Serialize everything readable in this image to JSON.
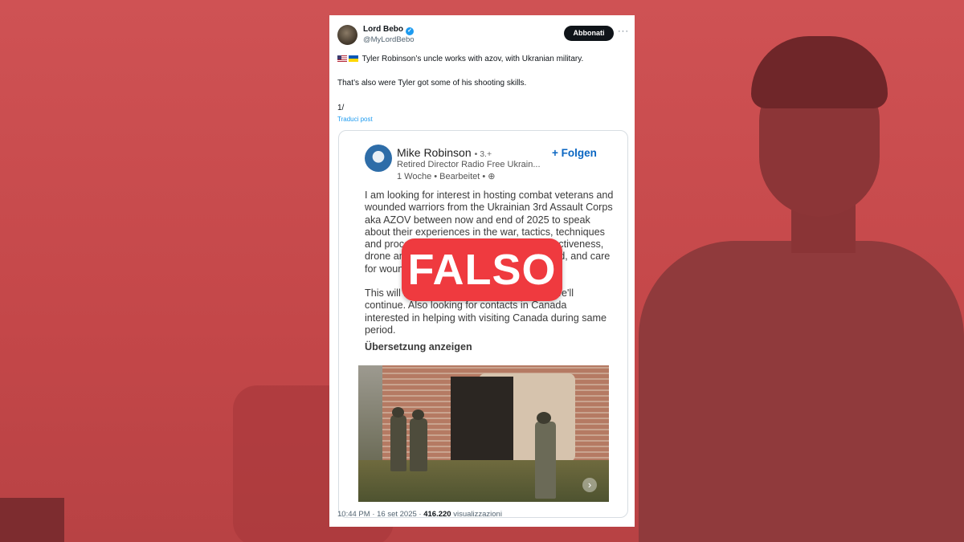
{
  "tweet": {
    "display_name": "Lord Bebo",
    "handle": "@MyLordBebo",
    "follow_label": "Abbonati",
    "more_label": "···",
    "line1": "Tyler Robinson’s uncle works with azov, with Ukranian military.",
    "line2": "That’s also were Tyler got some of his shooting skills.",
    "line3": "1/",
    "translate_label": "Traduci post",
    "time": "10:44 PM",
    "separator": "·",
    "date": "16 set 2025",
    "views_count": "416.220",
    "views_label": "visualizzazioni"
  },
  "linkedin": {
    "name": "Mike Robinson",
    "degree": "• 3.+",
    "follow_label": "+ Folgen",
    "title": "Retired Director Radio Free Ukrain...",
    "meta": "1 Woche • Bearbeitet •",
    "body_p1": "I am looking for interest in hosting combat veterans and wounded warriors from the  Ukrainian 3rd Assault Corps aka AZOV between now and end of 2025 to speak about their experiences in the war, tactics, techniques and procedures, casualty care, combat effectiveness, drone and other technology on the battlefield, and care for wounded warriors.",
    "body_p2": "This will be a process so let me know and we'll continue. Also looking for contacts in Canada interested in helping with visiting Canada during same period.",
    "translate_label": "Übersetzung anzeigen"
  },
  "overlay": {
    "verdict": "FALSO",
    "color": "#ef3a3f"
  },
  "icons": {
    "verified": "verified-badge-icon",
    "us_flag": "us-flag-icon",
    "ua_flag": "ukraine-flag-icon",
    "globe": "globe-icon",
    "next": "chevron-right-icon"
  }
}
